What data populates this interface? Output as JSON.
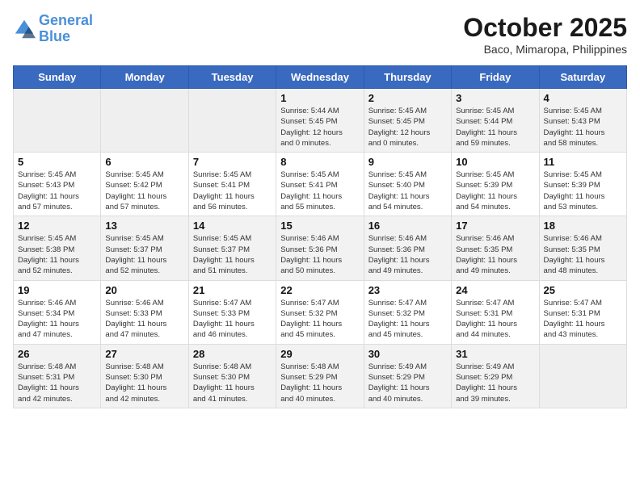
{
  "header": {
    "logo_line1": "General",
    "logo_line2": "Blue",
    "month": "October 2025",
    "location": "Baco, Mimaropa, Philippines"
  },
  "weekdays": [
    "Sunday",
    "Monday",
    "Tuesday",
    "Wednesday",
    "Thursday",
    "Friday",
    "Saturday"
  ],
  "weeks": [
    [
      {
        "day": "",
        "info": ""
      },
      {
        "day": "",
        "info": ""
      },
      {
        "day": "",
        "info": ""
      },
      {
        "day": "1",
        "info": "Sunrise: 5:44 AM\nSunset: 5:45 PM\nDaylight: 12 hours\nand 0 minutes."
      },
      {
        "day": "2",
        "info": "Sunrise: 5:45 AM\nSunset: 5:45 PM\nDaylight: 12 hours\nand 0 minutes."
      },
      {
        "day": "3",
        "info": "Sunrise: 5:45 AM\nSunset: 5:44 PM\nDaylight: 11 hours\nand 59 minutes."
      },
      {
        "day": "4",
        "info": "Sunrise: 5:45 AM\nSunset: 5:43 PM\nDaylight: 11 hours\nand 58 minutes."
      }
    ],
    [
      {
        "day": "5",
        "info": "Sunrise: 5:45 AM\nSunset: 5:43 PM\nDaylight: 11 hours\nand 57 minutes."
      },
      {
        "day": "6",
        "info": "Sunrise: 5:45 AM\nSunset: 5:42 PM\nDaylight: 11 hours\nand 57 minutes."
      },
      {
        "day": "7",
        "info": "Sunrise: 5:45 AM\nSunset: 5:41 PM\nDaylight: 11 hours\nand 56 minutes."
      },
      {
        "day": "8",
        "info": "Sunrise: 5:45 AM\nSunset: 5:41 PM\nDaylight: 11 hours\nand 55 minutes."
      },
      {
        "day": "9",
        "info": "Sunrise: 5:45 AM\nSunset: 5:40 PM\nDaylight: 11 hours\nand 54 minutes."
      },
      {
        "day": "10",
        "info": "Sunrise: 5:45 AM\nSunset: 5:39 PM\nDaylight: 11 hours\nand 54 minutes."
      },
      {
        "day": "11",
        "info": "Sunrise: 5:45 AM\nSunset: 5:39 PM\nDaylight: 11 hours\nand 53 minutes."
      }
    ],
    [
      {
        "day": "12",
        "info": "Sunrise: 5:45 AM\nSunset: 5:38 PM\nDaylight: 11 hours\nand 52 minutes."
      },
      {
        "day": "13",
        "info": "Sunrise: 5:45 AM\nSunset: 5:37 PM\nDaylight: 11 hours\nand 52 minutes."
      },
      {
        "day": "14",
        "info": "Sunrise: 5:45 AM\nSunset: 5:37 PM\nDaylight: 11 hours\nand 51 minutes."
      },
      {
        "day": "15",
        "info": "Sunrise: 5:46 AM\nSunset: 5:36 PM\nDaylight: 11 hours\nand 50 minutes."
      },
      {
        "day": "16",
        "info": "Sunrise: 5:46 AM\nSunset: 5:36 PM\nDaylight: 11 hours\nand 49 minutes."
      },
      {
        "day": "17",
        "info": "Sunrise: 5:46 AM\nSunset: 5:35 PM\nDaylight: 11 hours\nand 49 minutes."
      },
      {
        "day": "18",
        "info": "Sunrise: 5:46 AM\nSunset: 5:35 PM\nDaylight: 11 hours\nand 48 minutes."
      }
    ],
    [
      {
        "day": "19",
        "info": "Sunrise: 5:46 AM\nSunset: 5:34 PM\nDaylight: 11 hours\nand 47 minutes."
      },
      {
        "day": "20",
        "info": "Sunrise: 5:46 AM\nSunset: 5:33 PM\nDaylight: 11 hours\nand 47 minutes."
      },
      {
        "day": "21",
        "info": "Sunrise: 5:47 AM\nSunset: 5:33 PM\nDaylight: 11 hours\nand 46 minutes."
      },
      {
        "day": "22",
        "info": "Sunrise: 5:47 AM\nSunset: 5:32 PM\nDaylight: 11 hours\nand 45 minutes."
      },
      {
        "day": "23",
        "info": "Sunrise: 5:47 AM\nSunset: 5:32 PM\nDaylight: 11 hours\nand 45 minutes."
      },
      {
        "day": "24",
        "info": "Sunrise: 5:47 AM\nSunset: 5:31 PM\nDaylight: 11 hours\nand 44 minutes."
      },
      {
        "day": "25",
        "info": "Sunrise: 5:47 AM\nSunset: 5:31 PM\nDaylight: 11 hours\nand 43 minutes."
      }
    ],
    [
      {
        "day": "26",
        "info": "Sunrise: 5:48 AM\nSunset: 5:31 PM\nDaylight: 11 hours\nand 42 minutes."
      },
      {
        "day": "27",
        "info": "Sunrise: 5:48 AM\nSunset: 5:30 PM\nDaylight: 11 hours\nand 42 minutes."
      },
      {
        "day": "28",
        "info": "Sunrise: 5:48 AM\nSunset: 5:30 PM\nDaylight: 11 hours\nand 41 minutes."
      },
      {
        "day": "29",
        "info": "Sunrise: 5:48 AM\nSunset: 5:29 PM\nDaylight: 11 hours\nand 40 minutes."
      },
      {
        "day": "30",
        "info": "Sunrise: 5:49 AM\nSunset: 5:29 PM\nDaylight: 11 hours\nand 40 minutes."
      },
      {
        "day": "31",
        "info": "Sunrise: 5:49 AM\nSunset: 5:29 PM\nDaylight: 11 hours\nand 39 minutes."
      },
      {
        "day": "",
        "info": ""
      }
    ]
  ]
}
